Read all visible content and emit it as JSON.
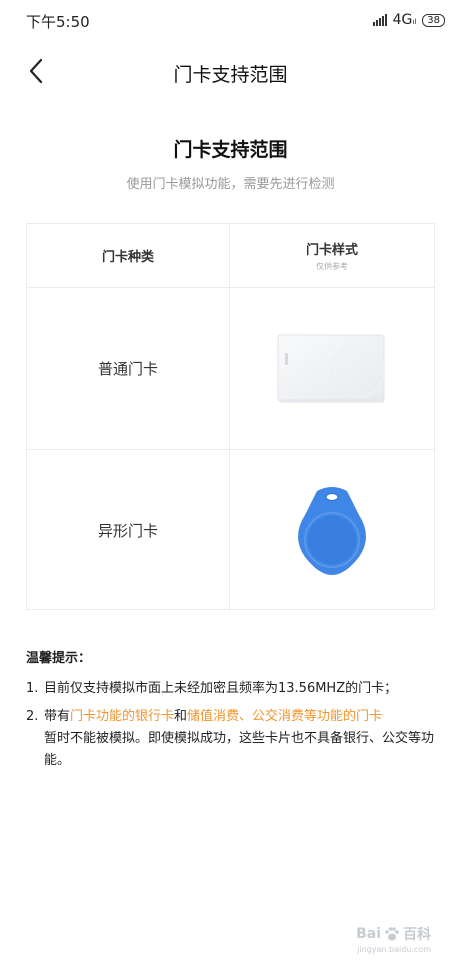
{
  "status_bar": {
    "time": "下午5:50",
    "network": "4G",
    "network_sub": "ıl",
    "battery": "38"
  },
  "navbar": {
    "title": "门卡支持范围"
  },
  "content": {
    "title": "门卡支持范围",
    "subtitle": "使用门卡模拟功能，需要先进行检测"
  },
  "table": {
    "header": {
      "col1": "门卡种类",
      "col2": "门卡样式",
      "col2_note": "仅供参考"
    },
    "rows": [
      {
        "type": "普通门卡",
        "image": "white-card-image"
      },
      {
        "type": "异形门卡",
        "image": "blue-fob-image"
      }
    ]
  },
  "tips": {
    "title": "温馨提示：",
    "items": [
      {
        "num": "1.",
        "text": "目前仅支持模拟市面上未经加密且频率为13.56MHZ的门卡；"
      },
      {
        "num": "2.",
        "pre": "带有",
        "hl1": "门卡功能的银行卡",
        "mid": "和",
        "hl2": "储值消费、公交消费等功能的门卡",
        "post": "暂时不能被模拟。即使模拟成功，这些卡片也不具备银行、公交等功能。"
      }
    ]
  },
  "watermark": {
    "text": "Bai",
    "text2": "百科",
    "sub": "jingyan.baidu.com"
  },
  "colors": {
    "highlight": "#f0952d",
    "fob_blue": "#3f86e6",
    "border": "#ececec"
  }
}
